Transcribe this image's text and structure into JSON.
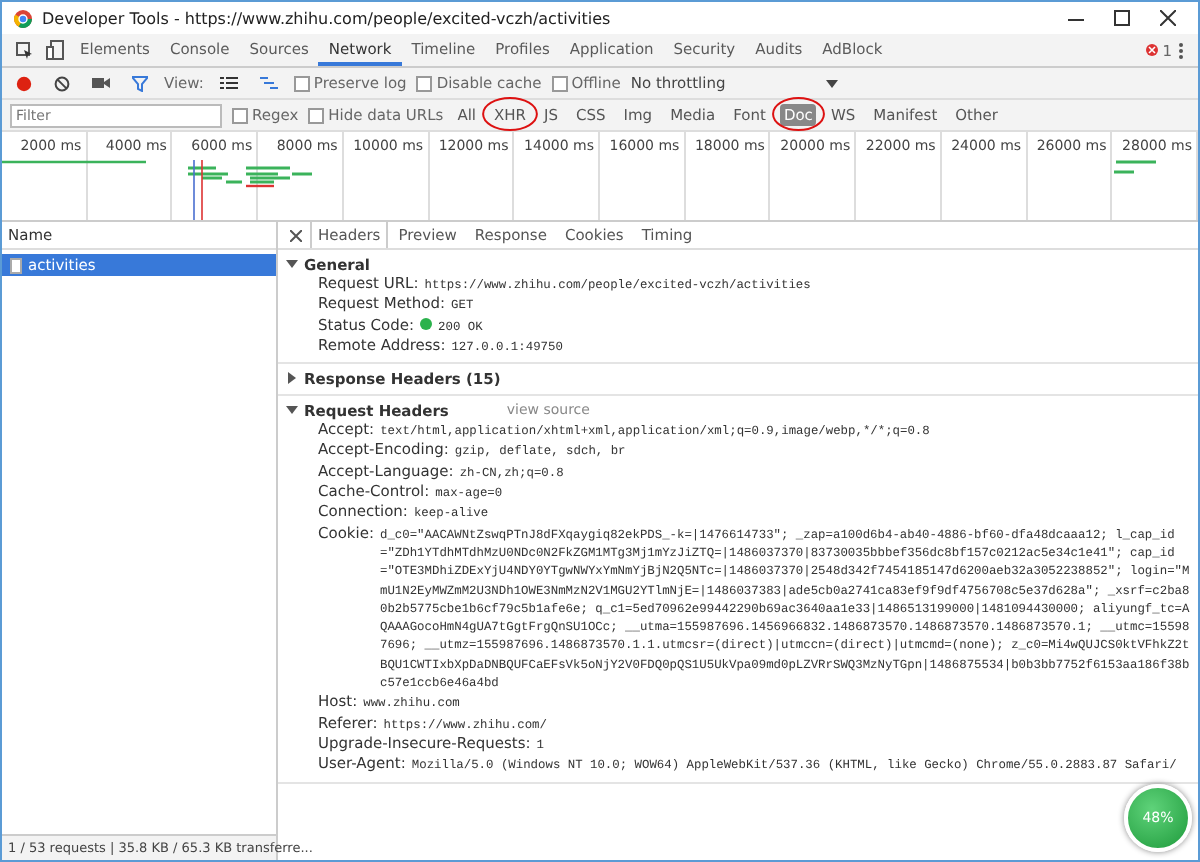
{
  "window": {
    "title": "Developer Tools - https://www.zhihu.com/people/excited-vczh/activities"
  },
  "tabs": [
    {
      "label": "Elements",
      "selected": false
    },
    {
      "label": "Console",
      "selected": false
    },
    {
      "label": "Sources",
      "selected": false
    },
    {
      "label": "Network",
      "selected": true
    },
    {
      "label": "Timeline",
      "selected": false
    },
    {
      "label": "Profiles",
      "selected": false
    },
    {
      "label": "Application",
      "selected": false
    },
    {
      "label": "Security",
      "selected": false
    },
    {
      "label": "Audits",
      "selected": false
    },
    {
      "label": "AdBlock",
      "selected": false
    }
  ],
  "error_count": "1",
  "toolbar": {
    "recording": true,
    "view_label": "View:",
    "preserve_log": {
      "label": "Preserve log",
      "checked": false
    },
    "disable_cache": {
      "label": "Disable cache",
      "checked": false
    },
    "offline": {
      "label": "Offline",
      "checked": false
    },
    "throttling": "No throttling"
  },
  "filter": {
    "placeholder": "Filter",
    "regex": {
      "label": "Regex",
      "checked": false
    },
    "hide_data_urls": {
      "label": "Hide data URLs",
      "checked": false
    },
    "types": [
      {
        "label": "All",
        "selected": false,
        "circled": false
      },
      {
        "label": "XHR",
        "selected": false,
        "circled": true
      },
      {
        "label": "JS",
        "selected": false,
        "circled": false
      },
      {
        "label": "CSS",
        "selected": false,
        "circled": false
      },
      {
        "label": "Img",
        "selected": false,
        "circled": false
      },
      {
        "label": "Media",
        "selected": false,
        "circled": false
      },
      {
        "label": "Font",
        "selected": false,
        "circled": false
      },
      {
        "label": "Doc",
        "selected": true,
        "circled": true
      },
      {
        "label": "WS",
        "selected": false,
        "circled": false
      },
      {
        "label": "Manifest",
        "selected": false,
        "circled": false
      },
      {
        "label": "Other",
        "selected": false,
        "circled": false
      }
    ]
  },
  "timeline": {
    "ticks": [
      "2000 ms",
      "4000 ms",
      "6000 ms",
      "8000 ms",
      "10000 ms",
      "12000 ms",
      "14000 ms",
      "16000 ms",
      "18000 ms",
      "20000 ms",
      "22000 ms",
      "24000 ms",
      "26000 ms",
      "28000 ms"
    ]
  },
  "requests": {
    "column": "Name",
    "rows": [
      {
        "name": "activities",
        "selected": true
      }
    ]
  },
  "details": {
    "tabs": [
      {
        "label": "Headers",
        "selected": true
      },
      {
        "label": "Preview",
        "selected": false
      },
      {
        "label": "Response",
        "selected": false
      },
      {
        "label": "Cookies",
        "selected": false
      },
      {
        "label": "Timing",
        "selected": false
      }
    ],
    "sections": [
      {
        "title": "General",
        "expanded": true,
        "rows": [
          {
            "name": "Request URL:",
            "value": "https://www.zhihu.com/people/excited-vczh/activities"
          },
          {
            "name": "Request Method:",
            "value": "GET"
          },
          {
            "name": "Status Code:",
            "value": "200 OK",
            "status_dot": true
          },
          {
            "name": "Remote Address:",
            "value": "127.0.0.1:49750"
          }
        ]
      },
      {
        "title": "Response Headers (15)",
        "expanded": false
      },
      {
        "title": "Request Headers",
        "expanded": true,
        "link": "view source",
        "rows": [
          {
            "name": "Accept:",
            "value": "text/html,application/xhtml+xml,application/xml;q=0.9,image/webp,*/*;q=0.8"
          },
          {
            "name": "Accept-Encoding:",
            "value": "gzip, deflate, sdch, br"
          },
          {
            "name": "Accept-Language:",
            "value": "zh-CN,zh;q=0.8"
          },
          {
            "name": "Cache-Control:",
            "value": "max-age=0"
          },
          {
            "name": "Connection:",
            "value": "keep-alive"
          },
          {
            "name": "Cookie:",
            "value": "d_c0=\"AACAWNtZswqPTnJ8dFXqaygiq82ekPDS_-k=|1476614733\"; _zap=a100d6b4-ab40-4886-bf60-dfa48dcaaa12; l_cap_id=\"ZDh1YTdhMTdhMzU0NDc0N2FkZGM1MTg3Mj1mYzJiZTQ=|1486037370|83730035bbbef356dc8bf157c0212ac5e34c1e41\"; cap_id=\"OTE3MDhiZDExYjU4NDY0YTgwNWYxYmNmYjBjN2Q5NTc=|1486037370|2548d342f7454185147d6200aeb32a3052238852\"; login=\"MmU1N2EyMWZmM2U3NDh1OWE3NmMzN2V1MGU2YTlmNjE=|1486037383|ade5cb0a2741ca83ef9f9df4756708c5e37d628a\"; _xsrf=c2ba80b2b5775cbe1b6cf79c5b1afe6e; q_c1=5ed70962e99442290b69ac3640aa1e33|1486513199000|1481094430000; aliyungf_tc=AQAAAGocoHmN4gUA7tGgtFrgQnSU1OCc; __utma=155987696.1456966832.1486873570.1486873570.1486873570.1; __utmc=155987696; __utmz=155987696.1486873570.1.1.utmcsr=(direct)|utmccn=(direct)|utmcmd=(none); z_c0=Mi4wQUJCS0ktVFhkZ2tBQU1CWTIxbXpDaDNBQUFCaEFsVk5oNjY2V0FDQ0pQS1U5UkVpa09md0pLZVRrSWQ3MzNyTGpn|1486875534|b0b3bb7752f6153aa186f38bc57e1ccb6e46a4bd"
          },
          {
            "name": "Host:",
            "value": "www.zhihu.com"
          },
          {
            "name": "Referer:",
            "value": "https://www.zhihu.com/"
          },
          {
            "name": "Upgrade-Insecure-Requests:",
            "value": "1"
          },
          {
            "name": "User-Agent:",
            "value": "Mozilla/5.0 (Windows NT 10.0; WOW64) AppleWebKit/537.36 (KHTML, like Gecko) Chrome/55.0.2883.87 Safari/"
          }
        ]
      }
    ]
  },
  "status_bar": "1 / 53 requests | 35.8 KB / 65.3 KB transferre...",
  "speed_widget": {
    "label": "48%"
  }
}
